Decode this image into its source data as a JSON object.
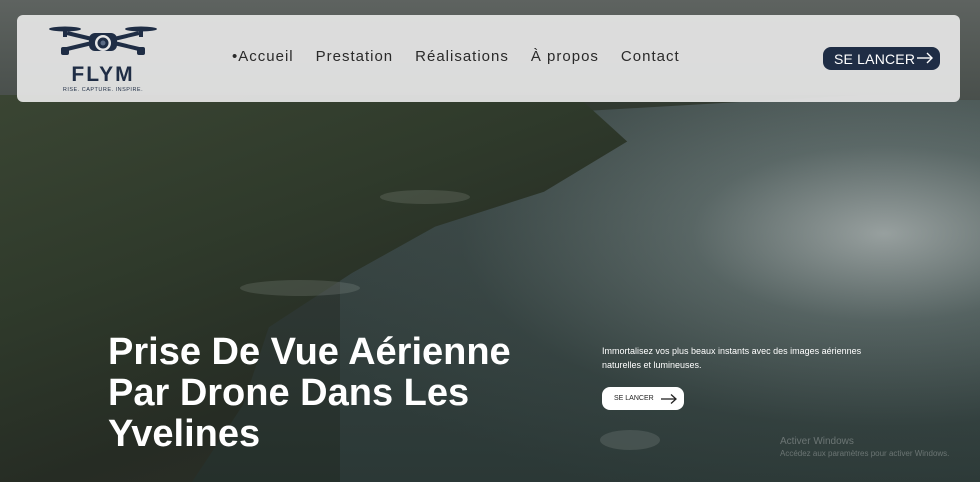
{
  "brand": {
    "name": "FLYM",
    "tagline": "RISE. CAPTURE. INSPIRE."
  },
  "nav": {
    "items": [
      {
        "label": "•Accueil",
        "active": true
      },
      {
        "label": "Prestation"
      },
      {
        "label": "Réalisations"
      },
      {
        "label": "À propos"
      },
      {
        "label": "Contact"
      }
    ]
  },
  "header_cta": {
    "label": "SE LANCER"
  },
  "hero": {
    "headline": "Prise De Vue Aérienne Par Drone Dans Les Yvelines",
    "subtitle": "Immortalisez vos plus beaux instants avec des images aériennes naturelles et lumineuses.",
    "cta_label": "SE LANCER"
  },
  "watermark": {
    "line1": "Activer Windows",
    "line2": "Accédez aux paramètres pour activer Windows."
  },
  "colors": {
    "brand_navy": "#1f2d45",
    "header_bg": "#e6e6e6",
    "text_white": "#ffffff"
  },
  "icons": {
    "arrow": "arrow-right-icon",
    "logo": "drone-icon"
  }
}
